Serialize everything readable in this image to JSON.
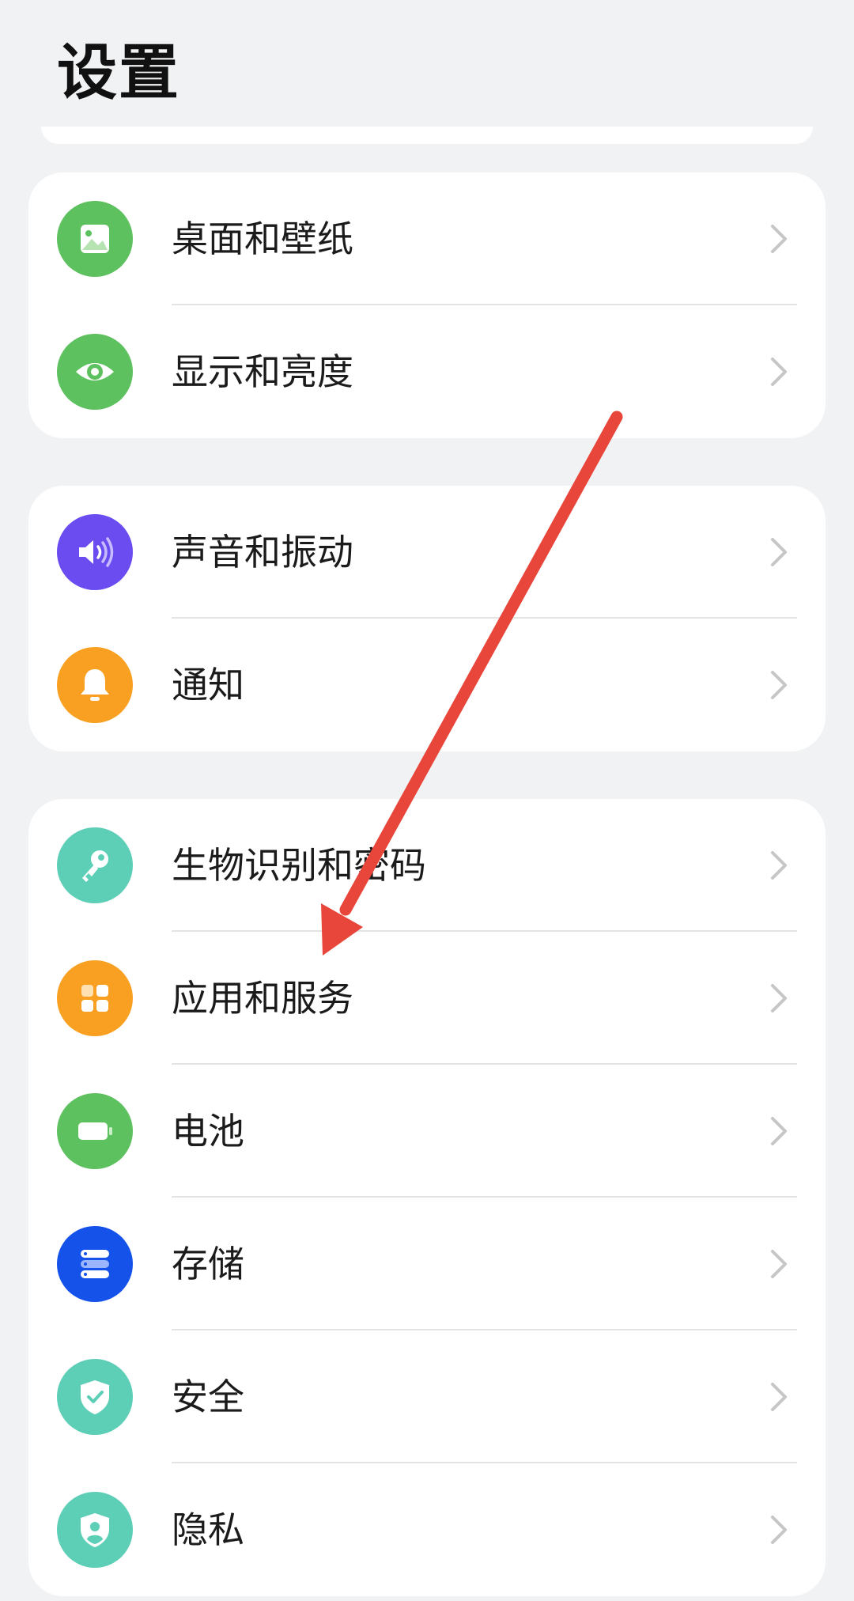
{
  "header": {
    "title": "设置"
  },
  "groups": [
    {
      "items": [
        {
          "label": "桌面和壁纸",
          "icon": "wallpaper-icon",
          "color": "#5ec15f"
        },
        {
          "label": "显示和亮度",
          "icon": "eye-icon",
          "color": "#5ec15f"
        }
      ]
    },
    {
      "items": [
        {
          "label": "声音和振动",
          "icon": "speaker-icon",
          "color": "#6a4cf0"
        },
        {
          "label": "通知",
          "icon": "bell-icon",
          "color": "#f9a022"
        }
      ]
    },
    {
      "items": [
        {
          "label": "生物识别和密码",
          "icon": "key-icon",
          "color": "#5ecfb7"
        },
        {
          "label": "应用和服务",
          "icon": "apps-grid-icon",
          "color": "#f9a022"
        },
        {
          "label": "电池",
          "icon": "battery-icon",
          "color": "#5ec15f"
        },
        {
          "label": "存储",
          "icon": "storage-icon",
          "color": "#1552ea"
        },
        {
          "label": "安全",
          "icon": "shield-check-icon",
          "color": "#5ecfb7"
        },
        {
          "label": "隐私",
          "icon": "privacy-shield-icon",
          "color": "#5ecfb7"
        }
      ]
    }
  ],
  "annotation": {
    "arrow_color": "#e8463a"
  }
}
